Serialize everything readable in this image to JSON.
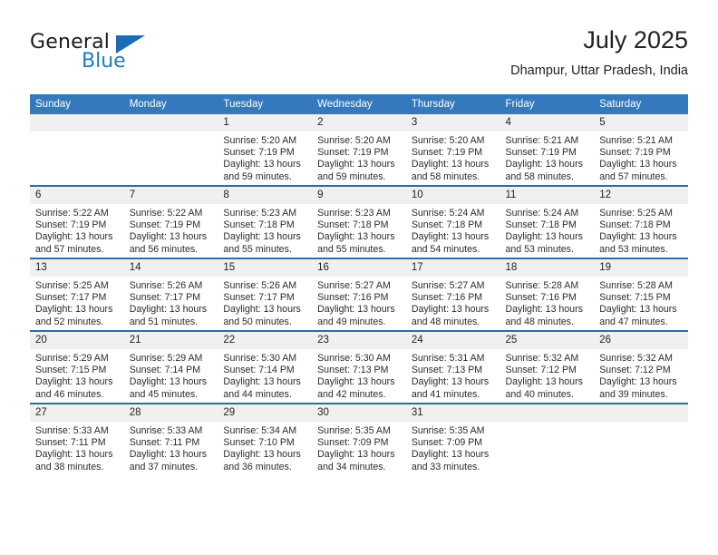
{
  "brand": {
    "name_part1": "General",
    "name_part2": "Blue",
    "triangle_icon": "triangle-icon",
    "colors": {
      "blue": "#1f7cc4",
      "dark_blue": "#1b6cb3",
      "text": "#1b1b1b"
    }
  },
  "header": {
    "title": "July 2025",
    "subtitle": "Dhampur, Uttar Pradesh, India"
  },
  "theme": {
    "header_blue": "#3479bb",
    "row_separator": "#2d6ca8",
    "daynum_band": "#f0f0f0"
  },
  "weekday_headers": [
    "Sunday",
    "Monday",
    "Tuesday",
    "Wednesday",
    "Thursday",
    "Friday",
    "Saturday"
  ],
  "labels": {
    "sunrise_prefix": "Sunrise:",
    "sunset_prefix": "Sunset:",
    "daylight_prefix": "Daylight:"
  },
  "weeks": [
    [
      {
        "day": "",
        "blank": true
      },
      {
        "day": "",
        "blank": true
      },
      {
        "day": "1",
        "sunrise": "Sunrise: 5:20 AM",
        "sunset": "Sunset: 7:19 PM",
        "daylight": "Daylight: 13 hours and 59 minutes."
      },
      {
        "day": "2",
        "sunrise": "Sunrise: 5:20 AM",
        "sunset": "Sunset: 7:19 PM",
        "daylight": "Daylight: 13 hours and 59 minutes."
      },
      {
        "day": "3",
        "sunrise": "Sunrise: 5:20 AM",
        "sunset": "Sunset: 7:19 PM",
        "daylight": "Daylight: 13 hours and 58 minutes."
      },
      {
        "day": "4",
        "sunrise": "Sunrise: 5:21 AM",
        "sunset": "Sunset: 7:19 PM",
        "daylight": "Daylight: 13 hours and 58 minutes."
      },
      {
        "day": "5",
        "sunrise": "Sunrise: 5:21 AM",
        "sunset": "Sunset: 7:19 PM",
        "daylight": "Daylight: 13 hours and 57 minutes."
      }
    ],
    [
      {
        "day": "6",
        "sunrise": "Sunrise: 5:22 AM",
        "sunset": "Sunset: 7:19 PM",
        "daylight": "Daylight: 13 hours and 57 minutes."
      },
      {
        "day": "7",
        "sunrise": "Sunrise: 5:22 AM",
        "sunset": "Sunset: 7:19 PM",
        "daylight": "Daylight: 13 hours and 56 minutes."
      },
      {
        "day": "8",
        "sunrise": "Sunrise: 5:23 AM",
        "sunset": "Sunset: 7:18 PM",
        "daylight": "Daylight: 13 hours and 55 minutes."
      },
      {
        "day": "9",
        "sunrise": "Sunrise: 5:23 AM",
        "sunset": "Sunset: 7:18 PM",
        "daylight": "Daylight: 13 hours and 55 minutes."
      },
      {
        "day": "10",
        "sunrise": "Sunrise: 5:24 AM",
        "sunset": "Sunset: 7:18 PM",
        "daylight": "Daylight: 13 hours and 54 minutes."
      },
      {
        "day": "11",
        "sunrise": "Sunrise: 5:24 AM",
        "sunset": "Sunset: 7:18 PM",
        "daylight": "Daylight: 13 hours and 53 minutes."
      },
      {
        "day": "12",
        "sunrise": "Sunrise: 5:25 AM",
        "sunset": "Sunset: 7:18 PM",
        "daylight": "Daylight: 13 hours and 53 minutes."
      }
    ],
    [
      {
        "day": "13",
        "sunrise": "Sunrise: 5:25 AM",
        "sunset": "Sunset: 7:17 PM",
        "daylight": "Daylight: 13 hours and 52 minutes."
      },
      {
        "day": "14",
        "sunrise": "Sunrise: 5:26 AM",
        "sunset": "Sunset: 7:17 PM",
        "daylight": "Daylight: 13 hours and 51 minutes."
      },
      {
        "day": "15",
        "sunrise": "Sunrise: 5:26 AM",
        "sunset": "Sunset: 7:17 PM",
        "daylight": "Daylight: 13 hours and 50 minutes."
      },
      {
        "day": "16",
        "sunrise": "Sunrise: 5:27 AM",
        "sunset": "Sunset: 7:16 PM",
        "daylight": "Daylight: 13 hours and 49 minutes."
      },
      {
        "day": "17",
        "sunrise": "Sunrise: 5:27 AM",
        "sunset": "Sunset: 7:16 PM",
        "daylight": "Daylight: 13 hours and 48 minutes."
      },
      {
        "day": "18",
        "sunrise": "Sunrise: 5:28 AM",
        "sunset": "Sunset: 7:16 PM",
        "daylight": "Daylight: 13 hours and 48 minutes."
      },
      {
        "day": "19",
        "sunrise": "Sunrise: 5:28 AM",
        "sunset": "Sunset: 7:15 PM",
        "daylight": "Daylight: 13 hours and 47 minutes."
      }
    ],
    [
      {
        "day": "20",
        "sunrise": "Sunrise: 5:29 AM",
        "sunset": "Sunset: 7:15 PM",
        "daylight": "Daylight: 13 hours and 46 minutes."
      },
      {
        "day": "21",
        "sunrise": "Sunrise: 5:29 AM",
        "sunset": "Sunset: 7:14 PM",
        "daylight": "Daylight: 13 hours and 45 minutes."
      },
      {
        "day": "22",
        "sunrise": "Sunrise: 5:30 AM",
        "sunset": "Sunset: 7:14 PM",
        "daylight": "Daylight: 13 hours and 44 minutes."
      },
      {
        "day": "23",
        "sunrise": "Sunrise: 5:30 AM",
        "sunset": "Sunset: 7:13 PM",
        "daylight": "Daylight: 13 hours and 42 minutes."
      },
      {
        "day": "24",
        "sunrise": "Sunrise: 5:31 AM",
        "sunset": "Sunset: 7:13 PM",
        "daylight": "Daylight: 13 hours and 41 minutes."
      },
      {
        "day": "25",
        "sunrise": "Sunrise: 5:32 AM",
        "sunset": "Sunset: 7:12 PM",
        "daylight": "Daylight: 13 hours and 40 minutes."
      },
      {
        "day": "26",
        "sunrise": "Sunrise: 5:32 AM",
        "sunset": "Sunset: 7:12 PM",
        "daylight": "Daylight: 13 hours and 39 minutes."
      }
    ],
    [
      {
        "day": "27",
        "sunrise": "Sunrise: 5:33 AM",
        "sunset": "Sunset: 7:11 PM",
        "daylight": "Daylight: 13 hours and 38 minutes."
      },
      {
        "day": "28",
        "sunrise": "Sunrise: 5:33 AM",
        "sunset": "Sunset: 7:11 PM",
        "daylight": "Daylight: 13 hours and 37 minutes."
      },
      {
        "day": "29",
        "sunrise": "Sunrise: 5:34 AM",
        "sunset": "Sunset: 7:10 PM",
        "daylight": "Daylight: 13 hours and 36 minutes."
      },
      {
        "day": "30",
        "sunrise": "Sunrise: 5:35 AM",
        "sunset": "Sunset: 7:09 PM",
        "daylight": "Daylight: 13 hours and 34 minutes."
      },
      {
        "day": "31",
        "sunrise": "Sunrise: 5:35 AM",
        "sunset": "Sunset: 7:09 PM",
        "daylight": "Daylight: 13 hours and 33 minutes."
      },
      {
        "day": "",
        "blank": true
      },
      {
        "day": "",
        "blank": true
      }
    ]
  ]
}
